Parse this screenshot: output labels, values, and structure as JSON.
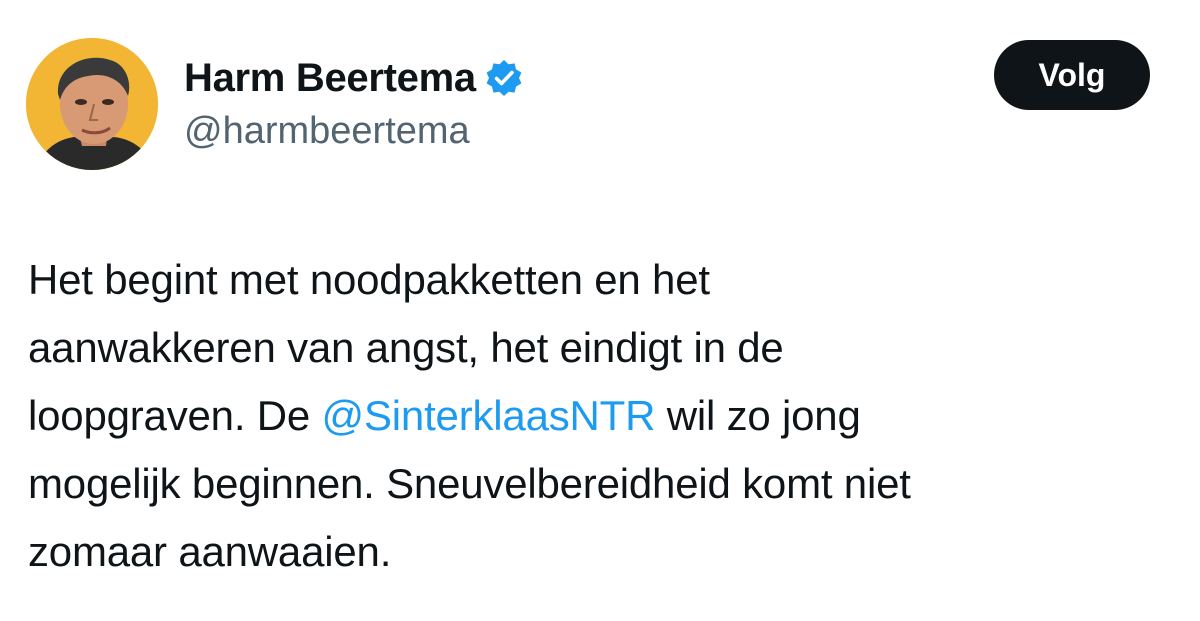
{
  "author": {
    "display_name": "Harm Beertema",
    "handle": "@harmbeertema",
    "avatar_icon": "portrait-avatar",
    "verified_icon": "verified-badge-icon",
    "verified_color": "#1d9bf0"
  },
  "follow_button": {
    "label": "Volg"
  },
  "tweet": {
    "line1": "Het begint met noodpakketten en het",
    "line2": "aanwakkeren van angst, het eindigt in de",
    "line3_before": "loopgraven. De ",
    "mention": "@SinterklaasNTR",
    "line3_after": " wil zo jong",
    "line4": "mogelijk beginnen. Sneuvelbereidheid komt niet",
    "line5": "zomaar aanwaaien."
  },
  "colors": {
    "text": "#0f1419",
    "secondary": "#536471",
    "link": "#1d9bf0",
    "button_bg": "#0f1419",
    "avatar_bg": "#f2b634"
  }
}
